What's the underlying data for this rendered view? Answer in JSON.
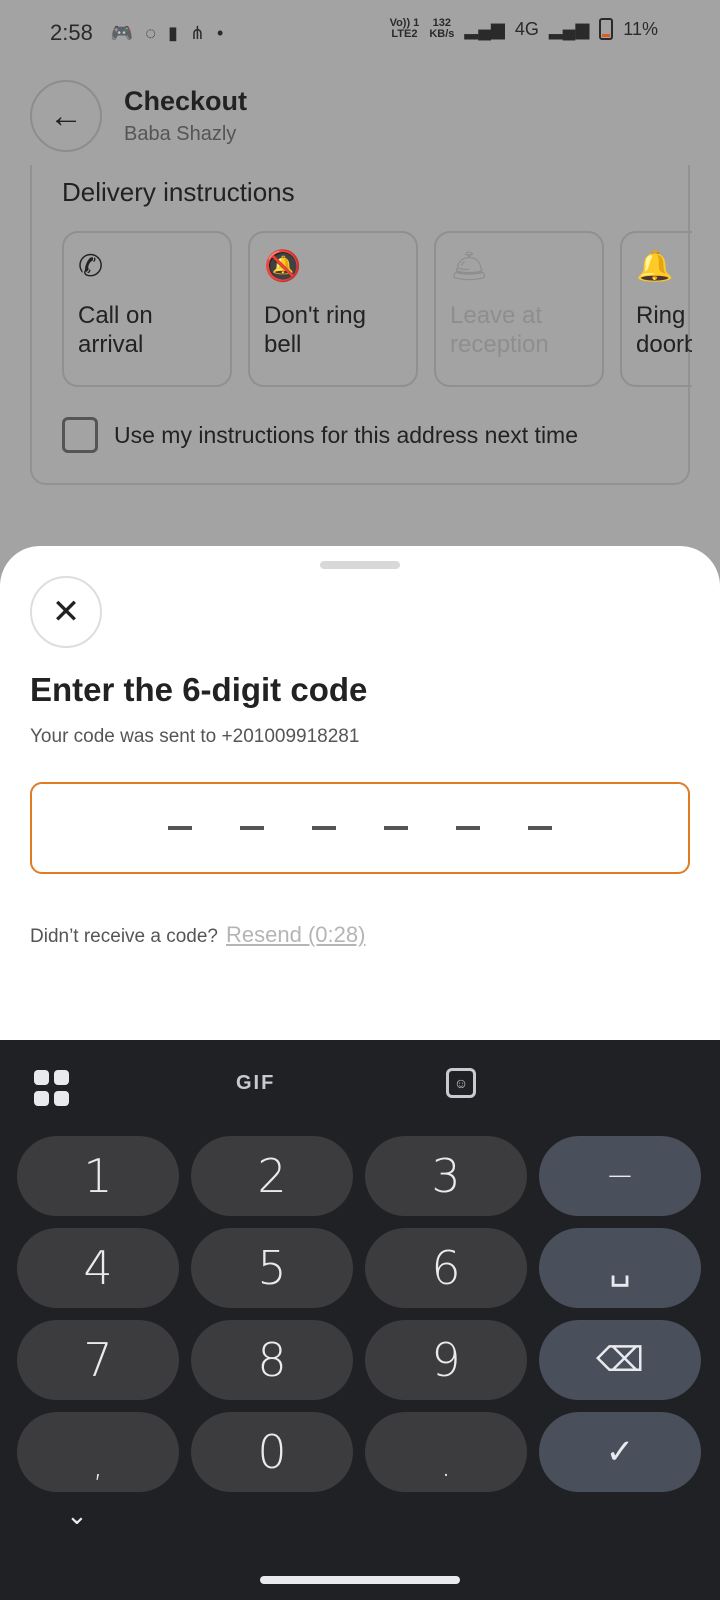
{
  "status_bar": {
    "time": "2:58",
    "net_label_top": "Vo)) 1",
    "net_label_bottom": "LTE2",
    "speed_top": "132",
    "speed_bottom": "KB/s",
    "network_4g": "4G",
    "battery_pct": "11%"
  },
  "header": {
    "title": "Checkout",
    "subtitle": "Baba Shazly",
    "back_glyph": "←"
  },
  "delivery": {
    "title": "Delivery instructions",
    "options": [
      {
        "label": "Call on arrival",
        "icon": "phone-icon",
        "glyph": "✆",
        "enabled": true
      },
      {
        "label": "Don't ring bell",
        "icon": "bell-off-icon",
        "glyph": "🔕",
        "enabled": true
      },
      {
        "label": "Leave at reception",
        "icon": "reception-bell-icon",
        "glyph": "🛎",
        "enabled": false
      },
      {
        "label": "Ring doorbell",
        "icon": "bell-icon",
        "glyph": "🔔",
        "enabled": true
      }
    ],
    "remember_label": "Use my instructions for this address next time"
  },
  "sheet": {
    "close_glyph": "✕",
    "title": "Enter the 6-digit code",
    "subtitle": "Your code was sent to +201009918281",
    "code_length": 6,
    "resend_question": "Didn’t receive a code?",
    "resend_link": "Resend (0:28)"
  },
  "keyboard": {
    "gif_label": "GIF",
    "keys": [
      {
        "label": "1",
        "name": "key-1"
      },
      {
        "label": "2",
        "name": "key-2"
      },
      {
        "label": "3",
        "name": "key-3"
      },
      {
        "label": "−",
        "name": "key-minus",
        "fn": true
      },
      {
        "label": "4",
        "name": "key-4"
      },
      {
        "label": "5",
        "name": "key-5"
      },
      {
        "label": "6",
        "name": "key-6"
      },
      {
        "label": "␣",
        "name": "key-space",
        "fn": true
      },
      {
        "label": "7",
        "name": "key-7"
      },
      {
        "label": "8",
        "name": "key-8"
      },
      {
        "label": "9",
        "name": "key-9"
      },
      {
        "label": "⌫",
        "name": "key-backspace",
        "fn": true
      },
      {
        "label": ",",
        "name": "key-comma",
        "sub": true
      },
      {
        "label": "0",
        "name": "key-0"
      },
      {
        "label": ".",
        "name": "key-period",
        "sub": true
      },
      {
        "label": "✓",
        "name": "key-done",
        "fn": true
      }
    ],
    "collapse_glyph": "⌄"
  },
  "colors": {
    "accent": "#e07b24",
    "scrim": "#a3a3a3",
    "keyboard_bg": "#202124"
  }
}
